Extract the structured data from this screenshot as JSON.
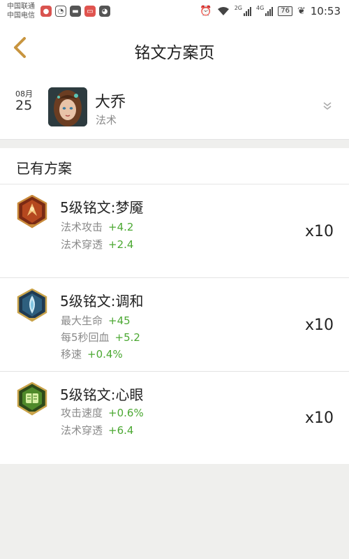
{
  "status_bar": {
    "carrier1": "中国联通",
    "carrier2": "中国电信",
    "network1": "2G",
    "network2": "4G",
    "battery": "76",
    "time": "10:53"
  },
  "header": {
    "title": "铭文方案页",
    "accent_color": "#c8953f"
  },
  "hero": {
    "month": "08月",
    "day": "25",
    "name": "大乔",
    "type": "法术"
  },
  "section": {
    "title": "已有方案"
  },
  "runes": [
    {
      "name": "5级铭文:梦魇",
      "icon": "nightmare-rune-icon",
      "stats": [
        {
          "label": "法术攻击",
          "value": "+4.2"
        },
        {
          "label": "法术穿透",
          "value": "+2.4"
        }
      ],
      "quantity": "x10"
    },
    {
      "name": "5级铭文:调和",
      "icon": "harmony-rune-icon",
      "stats": [
        {
          "label": "最大生命",
          "value": "+45"
        },
        {
          "label": "每5秒回血",
          "value": "+5.2"
        },
        {
          "label": "移速",
          "value": "+0.4%"
        }
      ],
      "quantity": "x10"
    },
    {
      "name": "5级铭文:心眼",
      "icon": "mind-eye-rune-icon",
      "stats": [
        {
          "label": "攻击速度",
          "value": "+0.6%"
        },
        {
          "label": "法术穿透",
          "value": "+6.4"
        }
      ],
      "quantity": "x10"
    }
  ]
}
